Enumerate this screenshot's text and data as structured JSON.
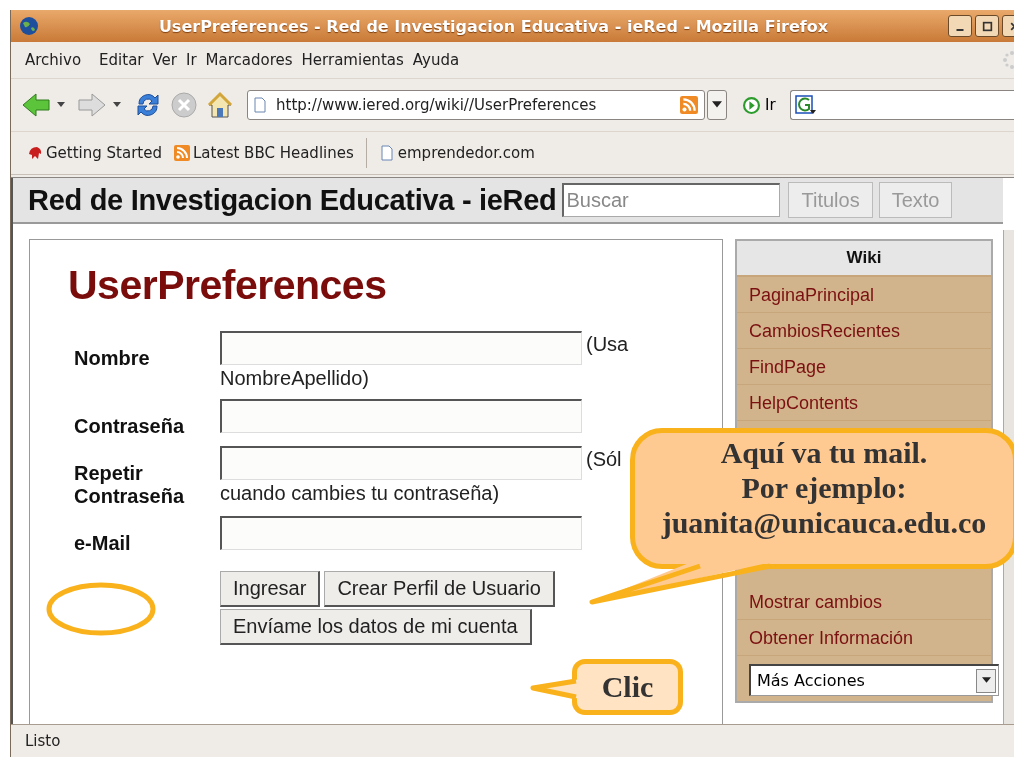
{
  "window": {
    "title": "UserPreferences - Red de Investigacion Educativa - ieRed - Mozilla Firefox"
  },
  "menu": [
    "Archivo",
    "Editar",
    "Ver",
    "Ir",
    "Marcadores",
    "Herramientas",
    "Ayuda"
  ],
  "navigation": {
    "address": "http://www.iered.org/wiki//UserPreferences",
    "go": "Ir"
  },
  "bookmarks": [
    {
      "label": "Getting Started",
      "kind": "start"
    },
    {
      "label": "Latest BBC Headlines",
      "kind": "feed"
    },
    {
      "label": "emprendedor.com",
      "kind": "page"
    }
  ],
  "site": {
    "title": "Red de Investigacion Educativa - ieRed",
    "search_placeholder": "Buscar",
    "search_buttons": [
      "Titulos",
      "Texto"
    ]
  },
  "page": {
    "heading": "UserPreferences",
    "fields": [
      {
        "label": "Nombre",
        "hint": [
          "(Usa",
          "NombreApellido)"
        ]
      },
      {
        "label": "Contraseña"
      },
      {
        "label": "Repetir Contraseña",
        "hint": [
          "(Sól",
          "cuando cambies tu contraseña)"
        ]
      },
      {
        "label": "e-Mail"
      }
    ],
    "buttons": [
      [
        "Ingresar",
        "Crear Perfil de Usuario"
      ],
      [
        "Envíame los datos de mi cuenta"
      ]
    ]
  },
  "sidebar": {
    "title": "Wiki",
    "items": [
      "PaginaPrincipal",
      "CambiosRecientes",
      "FindPage",
      "HelpContents",
      "Mostrar cambios",
      "Obtener Información"
    ],
    "actions": "Más Acciones"
  },
  "callouts": [
    {
      "kind": "large",
      "lines": [
        "Aquí va tu mail.",
        "Por ejemplo:",
        "juanita@unicauca.edu.co"
      ]
    },
    {
      "kind": "small",
      "lines": [
        "Clic"
      ]
    }
  ],
  "status_bar": "Listo"
}
